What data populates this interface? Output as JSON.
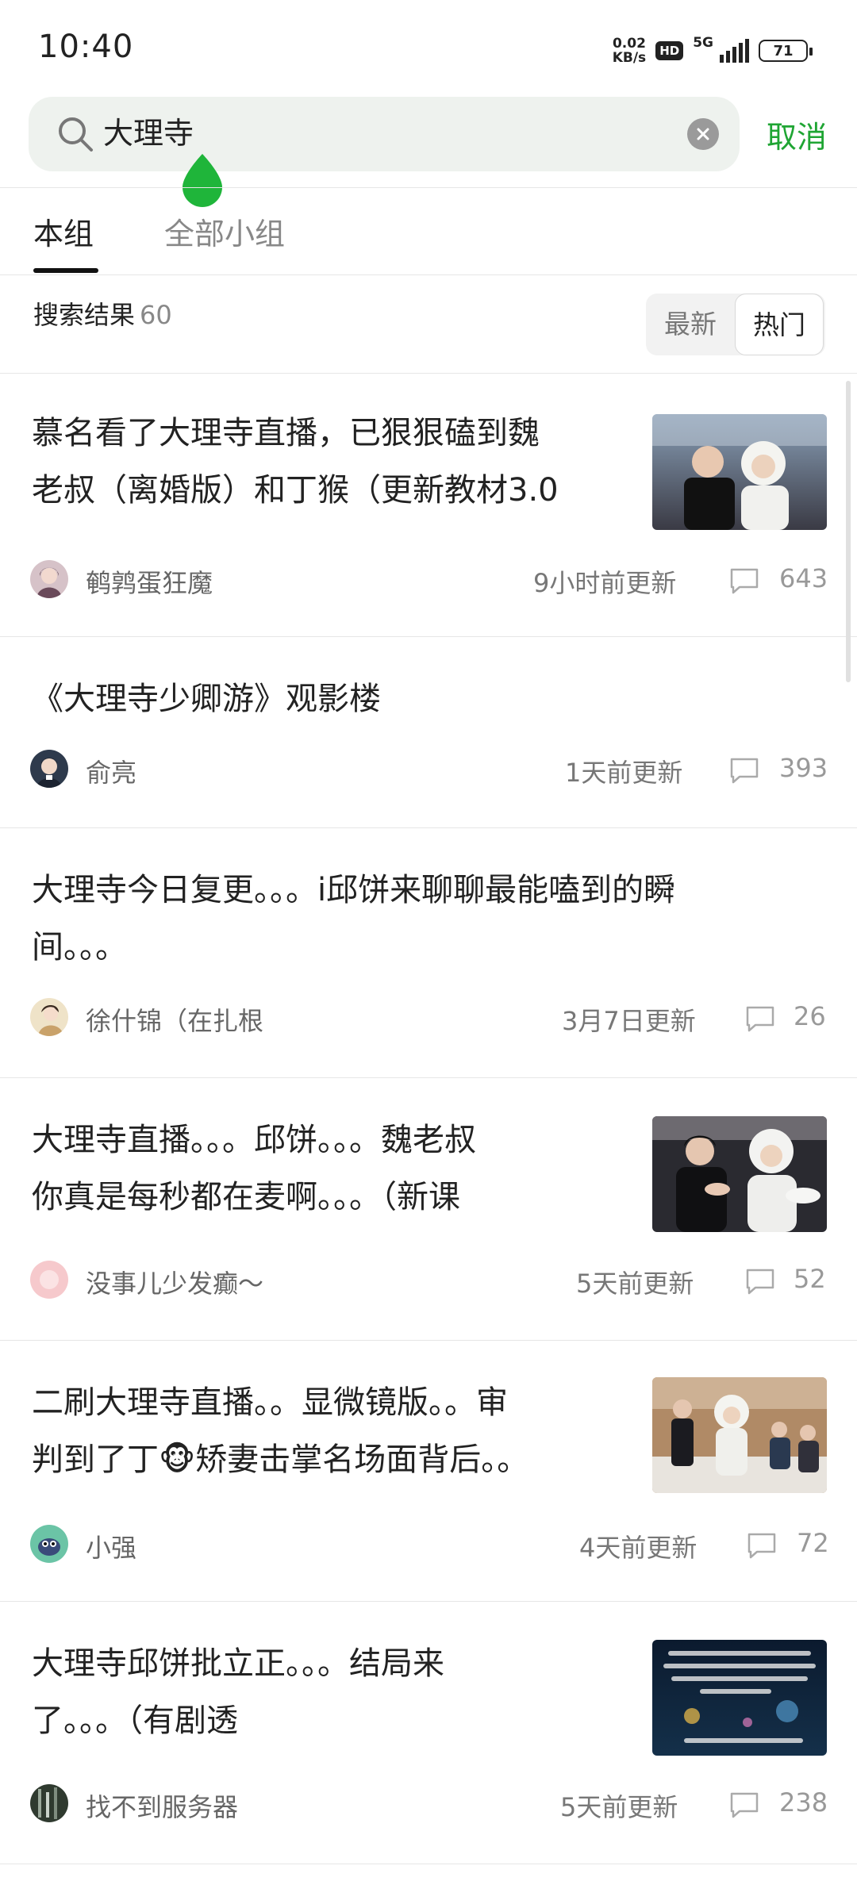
{
  "status_bar": {
    "time": "10:40",
    "net_speed": "0.02",
    "net_unit": "KB/s",
    "hd": "HD",
    "network": "5G",
    "battery": "71"
  },
  "search": {
    "query": "大理寺",
    "cancel_label": "取消"
  },
  "tabs": [
    {
      "label": "本组",
      "active": true
    },
    {
      "label": "全部小组",
      "active": false
    }
  ],
  "results": {
    "label": "搜索结果",
    "count": "60",
    "sort_options": [
      {
        "label": "最新",
        "selected": false
      },
      {
        "label": "热门",
        "selected": true
      }
    ]
  },
  "posts": [
    {
      "title_line1": "慕名看了大理寺直播，已狠狠磕到魏",
      "title_line2": "老叔（离婚版）和丁猴（更新教材3.0",
      "author": "鹌鹑蛋狂魔",
      "updated": "9小时前更新",
      "comments": "643"
    },
    {
      "title_line1": "《大理寺少卿游》观影楼",
      "author": "俞亮",
      "updated": "1天前更新",
      "comments": "393"
    },
    {
      "title_line1": "大理寺今日复更。。。i邱饼来聊聊最能嗑到的瞬",
      "title_line2": "间。。。",
      "author": "徐什锦（在扎根",
      "updated": "3月7日更新",
      "comments": "26"
    },
    {
      "title_line1": "大理寺直播。。。邱饼。。。魏老叔",
      "title_line2": "你真是每秒都在麦啊。。。（新课",
      "author": "没事儿少发癫～",
      "updated": "5天前更新",
      "comments": "52"
    },
    {
      "title_line1": "二刷大理寺直播。。显微镜版。。审",
      "title_line2": "判到了丁🐵矫妻击掌名场面背后。。",
      "author": "小强",
      "updated": "4天前更新",
      "comments": "72"
    },
    {
      "title_line1": "大理寺邱饼批立正。。。结局来",
      "title_line2": "了。。。（有剧透",
      "author": "找不到服务器",
      "updated": "5天前更新",
      "comments": "238"
    }
  ],
  "colors": {
    "accent": "#1fa533",
    "search_bg": "#eef2ee",
    "text_primary": "#222222",
    "text_secondary": "#777777"
  }
}
